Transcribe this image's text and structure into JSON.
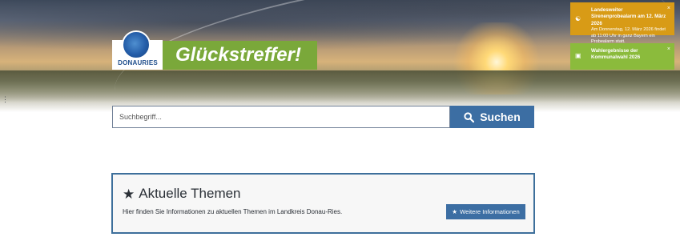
{
  "header": {
    "logo_text": "DONAURIES",
    "banner_text": "Glückstreffer!"
  },
  "notices": [
    {
      "title": "Landesweiter Sirenenprobealarm am 12. März 2026",
      "body": "Am Donnerstag, 12. März 2026 findet ab 11:00 Uhr in ganz Bayern ein Probealarm statt.",
      "icon": "megaphone-icon",
      "close": "×",
      "color": "#d89b16"
    },
    {
      "title": "Wahlergebnisse der Kommunalwahl 2026",
      "icon": "ballot-box-icon",
      "close": "×",
      "color": "#8bbb3c"
    }
  ],
  "search": {
    "placeholder": "Suchbegriff...",
    "button_label": "Suchen"
  },
  "topics": {
    "title": "Aktuelle Themen",
    "description": "Hier finden Sie Informationen zu aktuellen Themen im Landkreis Donau-Ries.",
    "button_label": "Weitere Informationen"
  },
  "colors": {
    "primary_blue": "#3c6ea3",
    "banner_green": "#7aa83a",
    "notice_orange": "#d89b16",
    "notice_green": "#8bbb3c"
  }
}
